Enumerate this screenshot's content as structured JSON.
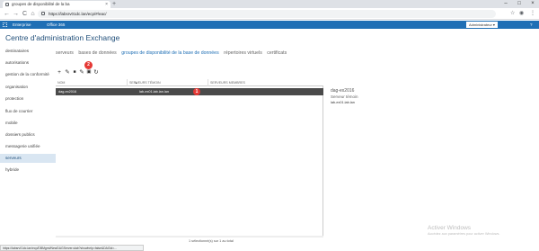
{
  "browser": {
    "tab_title": "groupes de disponibilité de la ba",
    "url": "https://labsrv01dc.lan/ecp/#/eac/",
    "buttons": {
      "back": "←",
      "forward": "→",
      "reload": "C",
      "home": "⌂",
      "new_tab": "+",
      "minimize": "–",
      "maximize": "□",
      "close": "×",
      "menu": "⋮",
      "star": "☆"
    }
  },
  "o365_bar": {
    "brand": "Enterprise",
    "app": "Office 365",
    "user": "Administrateur ▾",
    "help": "?"
  },
  "eac": {
    "title": "Centre d'administration Exchange"
  },
  "sidebar": {
    "items": [
      {
        "label": "destinataires",
        "active": false
      },
      {
        "label": "autorisations",
        "active": false
      },
      {
        "label": "gestion de la conformité",
        "active": false
      },
      {
        "label": "organisation",
        "active": false
      },
      {
        "label": "protection",
        "active": false
      },
      {
        "label": "flux de courrier",
        "active": false
      },
      {
        "label": "mobile",
        "active": false
      },
      {
        "label": "dossiers publics",
        "active": false
      },
      {
        "label": "messagerie unifiée",
        "active": false
      },
      {
        "label": "serveurs",
        "active": true
      },
      {
        "label": "hybride",
        "active": false
      }
    ]
  },
  "subnav": {
    "items": [
      {
        "label": "serveurs",
        "active": false
      },
      {
        "label": "bases de données",
        "active": false
      },
      {
        "label": "groupes de disponibilité de la base de données",
        "active": true
      },
      {
        "label": "répertoires virtuels",
        "active": false
      },
      {
        "label": "certificats",
        "active": false
      }
    ]
  },
  "actions": {
    "add": "+",
    "edit": "✎",
    "delete": "🗑",
    "manage": "✎",
    "add_server": "▣",
    "refresh": "↻",
    "badge_toolbar": "2"
  },
  "grid": {
    "headers": [
      "NOM",
      "SERVEURS TÉMOIN",
      "SERVEURS MEMBRES"
    ],
    "sort_indicator": "▲",
    "rows": [
      {
        "name": "dag-ex2016",
        "witness": "lab-ex01.lab.lan.lan",
        "members": ""
      }
    ],
    "row_badge": "1",
    "status": "1 sélectionné(s) sur 1 au total"
  },
  "details": {
    "title": "dag-ex2016",
    "subtitle": "Serveur témoin",
    "value": "lab-ex01.lab.lan"
  },
  "statusbar": {
    "url": "https://labsrv01dc.lan/ecp/DBMgmt/NewDAGServer.slab?showhelp=false&DAGid=..."
  },
  "watermark": {
    "line1": "Activer Windows",
    "line2": "Accédez aux paramètres pour activer Windows."
  },
  "colors": {
    "accent": "#1f6fb5",
    "o365_bar": "#1f6fb5",
    "selected_row": "#4a4a4a",
    "badge": "#e53935",
    "sidebar_active": "#d9e6f2"
  }
}
